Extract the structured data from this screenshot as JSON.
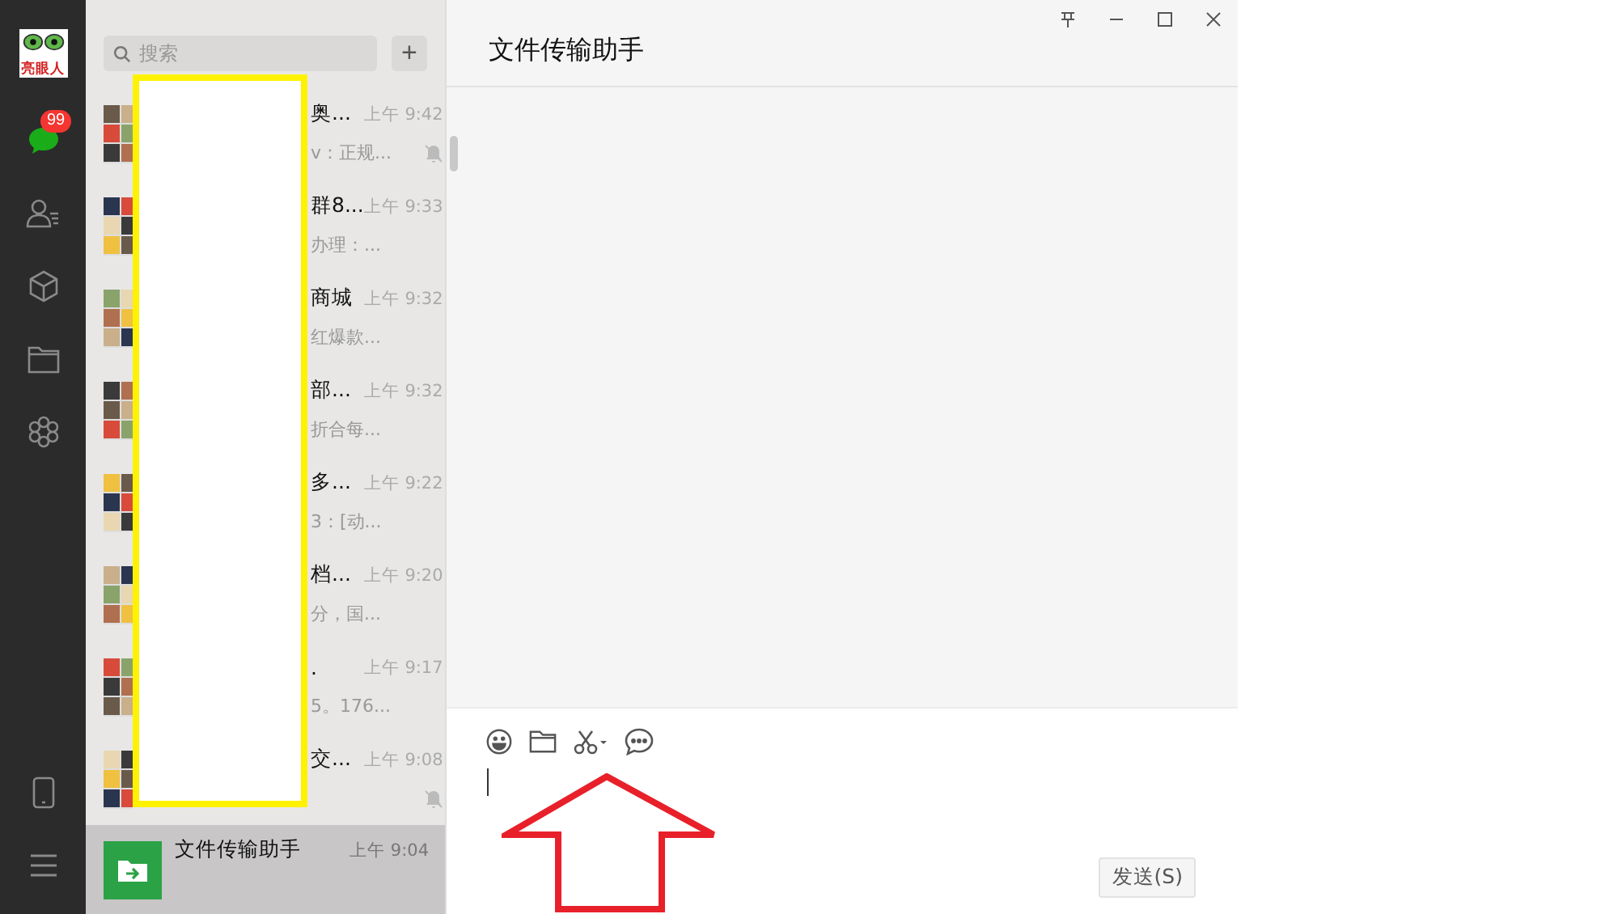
{
  "profile": {
    "logo_text": "亮眼人"
  },
  "nav": [
    {
      "kind": "chat",
      "badge": "99",
      "selected": true
    },
    {
      "kind": "contacts",
      "selected": false
    },
    {
      "kind": "box",
      "selected": false
    },
    {
      "kind": "folder",
      "selected": false
    },
    {
      "kind": "apps",
      "selected": false
    }
  ],
  "nav_bottom": [
    {
      "kind": "phone"
    },
    {
      "kind": "menu"
    }
  ],
  "search": {
    "placeholder": "搜索",
    "add_label": "+"
  },
  "chats": [
    {
      "name": "奥...",
      "preview": "v：正规...",
      "time": "上午 9:42",
      "muted": true,
      "selected": false
    },
    {
      "name": "群8...",
      "preview": "办理：...",
      "time": "上午 9:33",
      "muted": false,
      "selected": false
    },
    {
      "name": "商城",
      "preview": "红爆款...",
      "time": "上午 9:32",
      "muted": false,
      "selected": false
    },
    {
      "name": "部...",
      "preview": "折合每...",
      "time": "上午 9:32",
      "muted": false,
      "selected": false
    },
    {
      "name": "多...",
      "preview": "3：[动...",
      "time": "上午 9:22",
      "muted": false,
      "selected": false
    },
    {
      "name": "档...",
      "preview": "分，国...",
      "time": "上午 9:20",
      "muted": false,
      "selected": false
    },
    {
      "name": ".",
      "preview": "5。176...",
      "time": "上午 9:17",
      "muted": false,
      "selected": false
    },
    {
      "name": "交...",
      "time": "上午 9:08",
      "muted": true,
      "selected": false
    },
    {
      "name": "文件传输助手",
      "time": "上午 9:04",
      "muted": false,
      "selected": true,
      "kind": "file"
    }
  ],
  "conversation": {
    "title": "文件传输助手",
    "send_label": "发送(S)"
  }
}
